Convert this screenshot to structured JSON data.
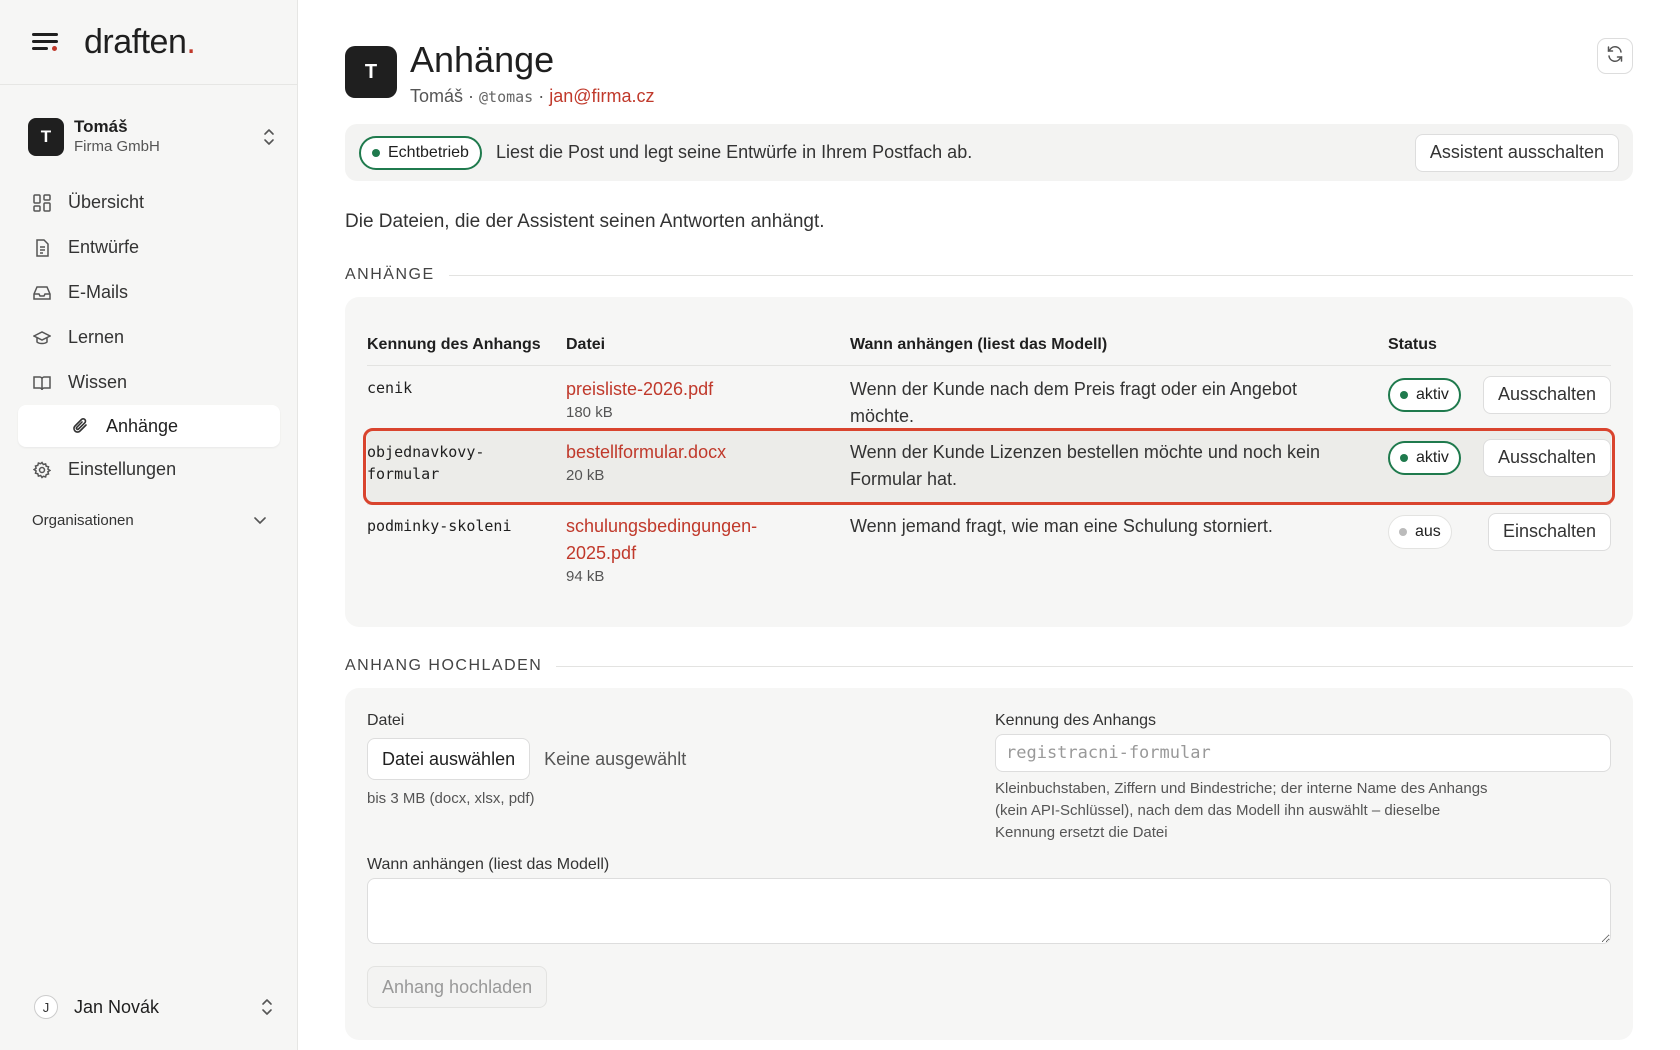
{
  "brand": {
    "name": "draften",
    "dot": "."
  },
  "org": {
    "initial": "T",
    "name": "Tomáš",
    "company": "Firma GmbH"
  },
  "nav": {
    "items": [
      {
        "label": "Übersicht",
        "icon": "dashboard-icon"
      },
      {
        "label": "Entwürfe",
        "icon": "document-icon"
      },
      {
        "label": "E-Mails",
        "icon": "inbox-icon"
      },
      {
        "label": "Lernen",
        "icon": "graduation-cap-icon"
      },
      {
        "label": "Wissen",
        "icon": "book-icon"
      },
      {
        "label": "Anhänge",
        "icon": "paperclip-icon",
        "active": true
      },
      {
        "label": "Einstellungen",
        "icon": "gear-icon"
      }
    ],
    "organisations_label": "Organisationen"
  },
  "user": {
    "initial": "J",
    "name": "Jan Novák"
  },
  "header": {
    "initial": "T",
    "title": "Anhänge",
    "name": "Tomáš",
    "sep": " · ",
    "handle": "@tomas",
    "email": "jan@firma.cz"
  },
  "statusbar": {
    "pill": "Echtbetrieb",
    "text": "Liest die Post und legt seine Entwürfe in Ihrem Postfach ab.",
    "button": "Assistent ausschalten"
  },
  "description": "Die Dateien, die der Assistent seinen Antworten anhängt.",
  "attachments": {
    "section_title": "ANHÄNGE",
    "columns": [
      "Kennung des Anhangs",
      "Datei",
      "Wann anhängen (liest das Modell)",
      "Status"
    ],
    "rows": [
      {
        "id": "cenik",
        "file": "preisliste-2026.pdf",
        "size": "180 kB",
        "when": "Wenn der Kunde nach dem Preis fragt oder ein Angebot möchte.",
        "status": "aktiv",
        "action": "Ausschalten"
      },
      {
        "id": "objednavkovy-formular",
        "file": "bestellformular.docx",
        "size": "20 kB",
        "when": "Wenn der Kunde Lizenzen bestellen möchte und noch kein Formular hat.",
        "status": "aktiv",
        "action": "Ausschalten"
      },
      {
        "id": "podminky-skoleni",
        "file": "schulungsbedingungen-2025.pdf",
        "size": "94 kB",
        "when": "Wenn jemand fragt, wie man eine Schulung storniert.",
        "status": "aus",
        "action": "Einschalten"
      }
    ]
  },
  "upload": {
    "section_title": "ANHANG HOCHLADEN",
    "file_label": "Datei",
    "file_button": "Datei auswählen",
    "file_none": "Keine ausgewählt",
    "file_hint": "bis 3 MB (docx, xlsx, pdf)",
    "id_label": "Kennung des Anhangs",
    "id_placeholder": "registracni-formular",
    "id_hint": "Kleinbuchstaben, Ziffern und Bindestriche; der interne Name des Anhangs (kein API-Schlüssel), nach dem das Modell ihn auswählt – dieselbe Kennung ersetzt die Datei",
    "when_label": "Wann anhängen (liest das Modell)",
    "submit": "Anhang hochladen"
  }
}
